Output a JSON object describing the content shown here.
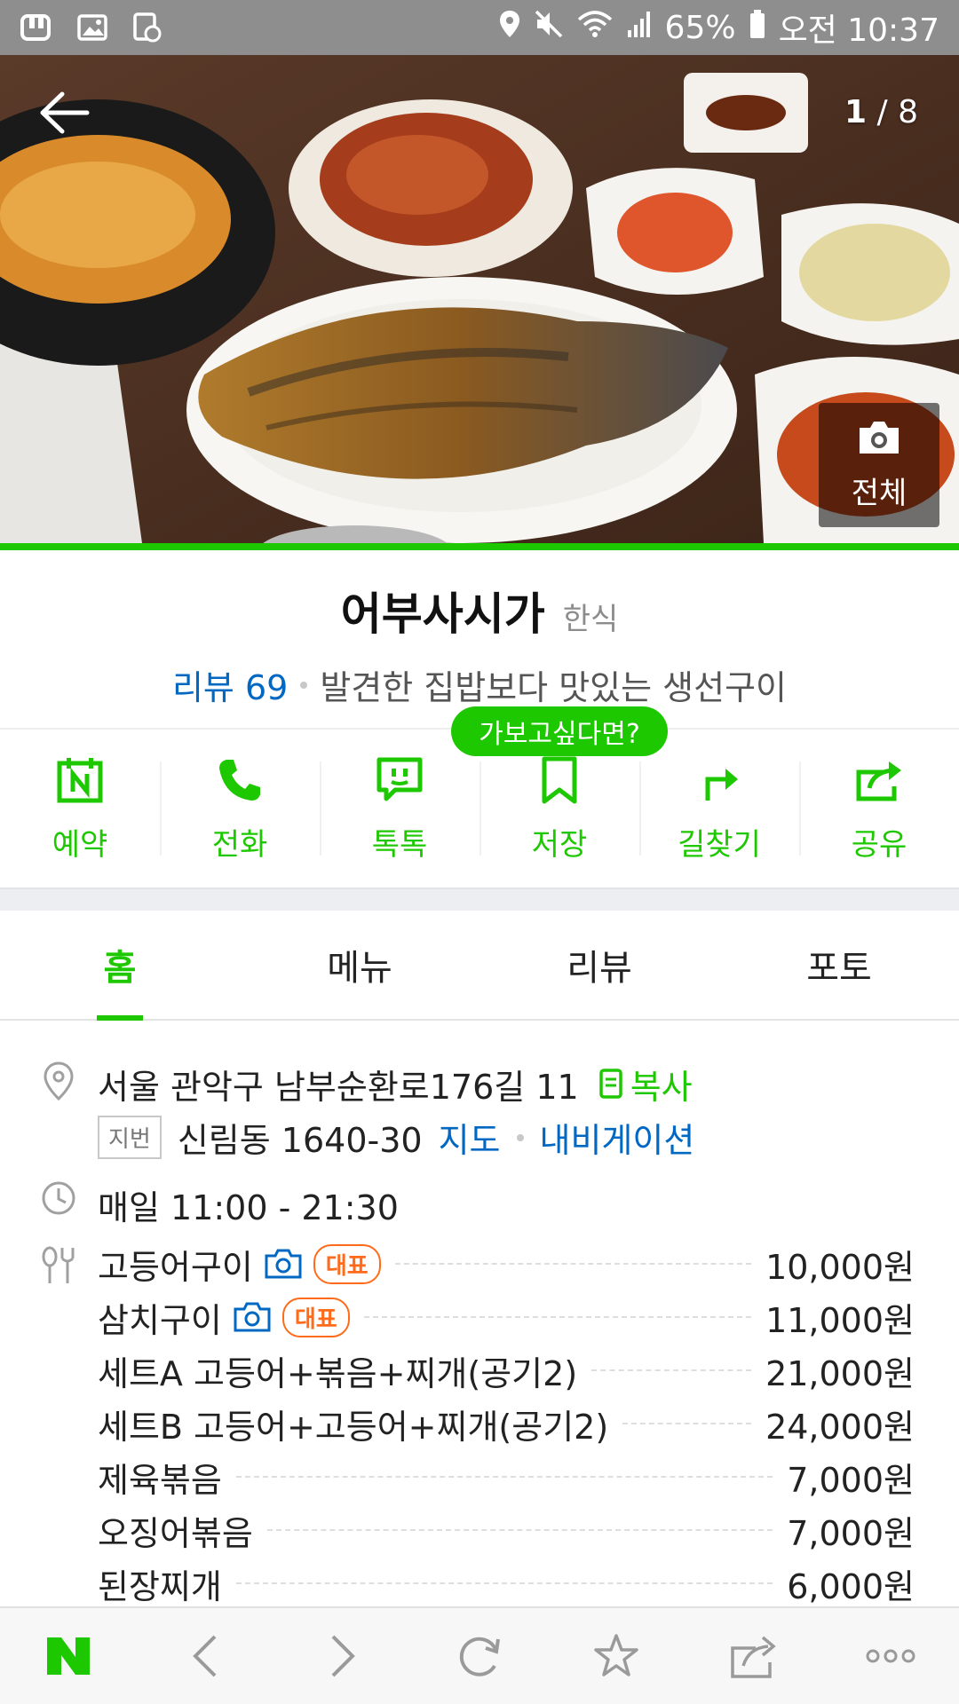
{
  "status_bar": {
    "battery": "65%",
    "time": "오전 10:37",
    "left_icons": [
      "usb-icon",
      "image-icon",
      "sync-icon"
    ],
    "right_icons": [
      "location-icon",
      "mute-icon",
      "wifi-icon",
      "signal-icon",
      "battery-icon"
    ]
  },
  "hero": {
    "counter_current": "1",
    "counter_total": " / 8",
    "all_photos_label": "전체"
  },
  "place": {
    "name": "어부사시가",
    "category": "한식",
    "review_label": "리뷰 69",
    "tagline": "발견한 집밥보다 맛있는 생선구이"
  },
  "tooltip": "가보고싶다면?",
  "actions": [
    {
      "label": "예약",
      "icon": "calendar-n-icon"
    },
    {
      "label": "전화",
      "icon": "phone-icon"
    },
    {
      "label": "톡톡",
      "icon": "chat-icon"
    },
    {
      "label": "저장",
      "icon": "bookmark-icon"
    },
    {
      "label": "길찾기",
      "icon": "directions-icon"
    },
    {
      "label": "공유",
      "icon": "share-icon"
    }
  ],
  "tabs": [
    {
      "label": "홈",
      "active": true
    },
    {
      "label": "메뉴",
      "active": false
    },
    {
      "label": "리뷰",
      "active": false
    },
    {
      "label": "포토",
      "active": false
    }
  ],
  "info": {
    "address": "서울 관악구 남부순환로176길 11",
    "copy_label": "복사",
    "jibun_tag": "지번",
    "jibun_address": "신림동 1640-30",
    "map_link": "지도",
    "navigation_link": "내비게이션",
    "hours": "매일 11:00 - 21:30",
    "menu": [
      {
        "name": "고등어구이",
        "price": "10,000원",
        "photo": true,
        "badge": "대표"
      },
      {
        "name": "삼치구이",
        "price": "11,000원",
        "photo": true,
        "badge": "대표"
      },
      {
        "name": "세트A 고등어+볶음+찌개(공기2)",
        "price": "21,000원"
      },
      {
        "name": "세트B 고등어+고등어+찌개(공기2)",
        "price": "24,000원"
      },
      {
        "name": "제육볶음",
        "price": "7,000원"
      },
      {
        "name": "오징어볶음",
        "price": "7,000원"
      },
      {
        "name": "된장찌개",
        "price": "6,000원"
      }
    ]
  },
  "colors": {
    "accent": "#1ec800",
    "link": "#0068c3",
    "badge": "#ff6b1a",
    "status_bar": "#8e8e8e"
  },
  "bottom_bar": [
    "naver-logo-icon",
    "back-icon",
    "forward-icon",
    "refresh-icon",
    "star-icon",
    "share-icon",
    "more-icon"
  ]
}
